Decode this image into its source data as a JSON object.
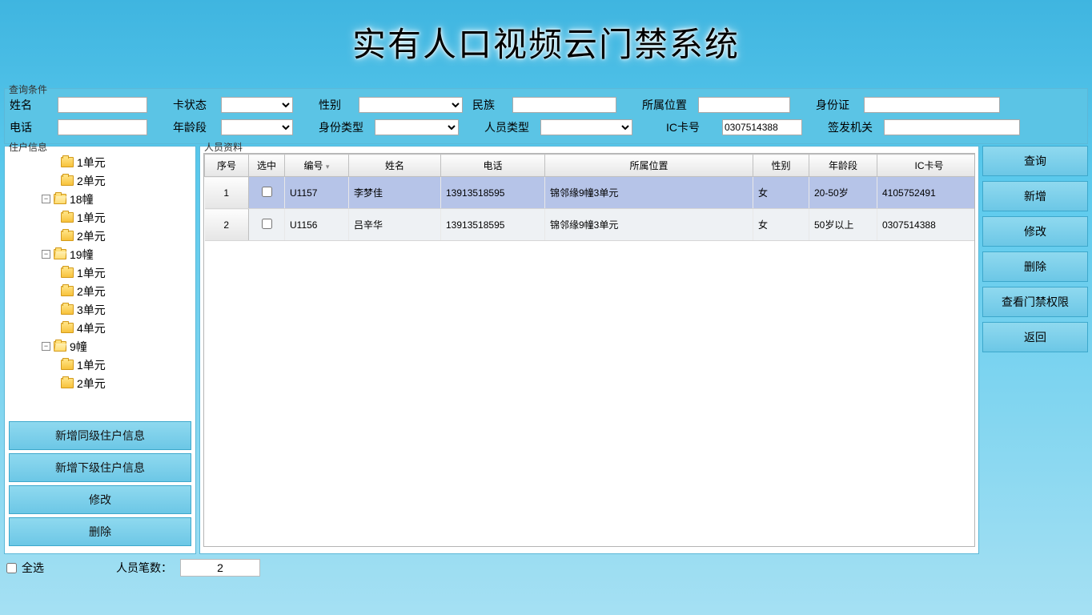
{
  "title": "实有人口视频云门禁系统",
  "filters": {
    "legend": "查询条件",
    "name_label": "姓名",
    "cardstate_label": "卡状态",
    "sex_label": "性别",
    "ethnic_label": "民族",
    "location_label": "所属位置",
    "idnum_label": "身份证",
    "phone_label": "电话",
    "agerange_label": "年龄段",
    "idtype_label": "身份类型",
    "ptype_label": "人员类型",
    "iccard_label": "IC卡号",
    "iccard_value": "0307514388",
    "issuer_label": "签发机关"
  },
  "left": {
    "legend": "住户信息",
    "tree": [
      {
        "indent": 70,
        "open": false,
        "label": "1单元"
      },
      {
        "indent": 70,
        "open": false,
        "label": "2单元"
      },
      {
        "indent": 46,
        "exp": "-",
        "open": true,
        "label": "18幢"
      },
      {
        "indent": 70,
        "open": false,
        "label": "1单元"
      },
      {
        "indent": 70,
        "open": false,
        "label": "2单元"
      },
      {
        "indent": 46,
        "exp": "-",
        "open": true,
        "label": "19幢"
      },
      {
        "indent": 70,
        "open": false,
        "label": "1单元"
      },
      {
        "indent": 70,
        "open": false,
        "label": "2单元"
      },
      {
        "indent": 70,
        "open": false,
        "label": "3单元"
      },
      {
        "indent": 70,
        "open": false,
        "label": "4单元"
      },
      {
        "indent": 46,
        "exp": "-",
        "open": true,
        "label": "9幢"
      },
      {
        "indent": 70,
        "open": false,
        "label": "1单元"
      },
      {
        "indent": 70,
        "open": false,
        "label": "2单元"
      }
    ],
    "btn_add_sibling": "新增同级住户信息",
    "btn_add_child": "新增下级住户信息",
    "btn_edit": "修改",
    "btn_delete": "删除"
  },
  "mid": {
    "legend": "人员资料",
    "headers": {
      "seq": "序号",
      "sel": "选中",
      "id": "编号",
      "name": "姓名",
      "phone": "电话",
      "loc": "所属位置",
      "sex": "性别",
      "age": "年龄段",
      "ic": "IC卡号"
    },
    "rows": [
      {
        "seq": "1",
        "id": "U1157",
        "name": "李梦佳",
        "phone": "13913518595",
        "loc": "锦邻缘9幢3单元",
        "sex": "女",
        "age": "20-50岁",
        "ic": "4105752491",
        "selected": true
      },
      {
        "seq": "2",
        "id": "U1156",
        "name": "吕辛华",
        "phone": "13913518595",
        "loc": "锦邻缘9幢3单元",
        "sex": "女",
        "age": "50岁以上",
        "ic": "0307514388",
        "selected": false
      }
    ]
  },
  "right": {
    "query": "查询",
    "add": "新增",
    "edit": "修改",
    "delete": "删除",
    "perm": "查看门禁权限",
    "back": "返回"
  },
  "footer": {
    "selectall": "全选",
    "count_label": "人员笔数：",
    "count_value": "2"
  }
}
